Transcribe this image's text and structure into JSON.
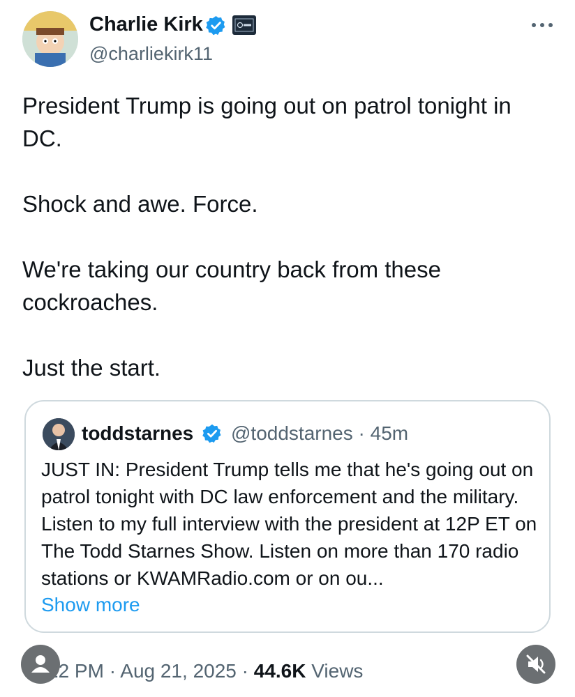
{
  "author": {
    "name": "Charlie Kirk",
    "handle": "@charliekirk11",
    "avatar_icon": "cartoon-avatar-icon",
    "verified": true
  },
  "tweet": {
    "paragraphs": [
      "President Trump is going out on patrol tonight in DC.",
      "Shock and awe. Force.",
      "We're taking our country back from these cockroaches.",
      "Just the start."
    ]
  },
  "quoted": {
    "name": "toddstarnes",
    "handle": "@toddstarnes · 45m",
    "verified": true,
    "text": "JUST IN: President Trump tells me that he's going out on patrol tonight with DC law enforcement and the military. Listen to my full interview with the president at 12P ET on The Todd Starnes Show. Listen on more than 170 radio stations or KWAMRadio.com or on ou...",
    "show_more": "Show more"
  },
  "meta": {
    "time_date": "22 PM · Aug 21, 2025 · ",
    "views_count": "44.6K",
    "views_label": " Views"
  },
  "colors": {
    "verified_blue": "#1d9bf0",
    "secondary_text": "#536471",
    "border": "#cfd9de"
  }
}
